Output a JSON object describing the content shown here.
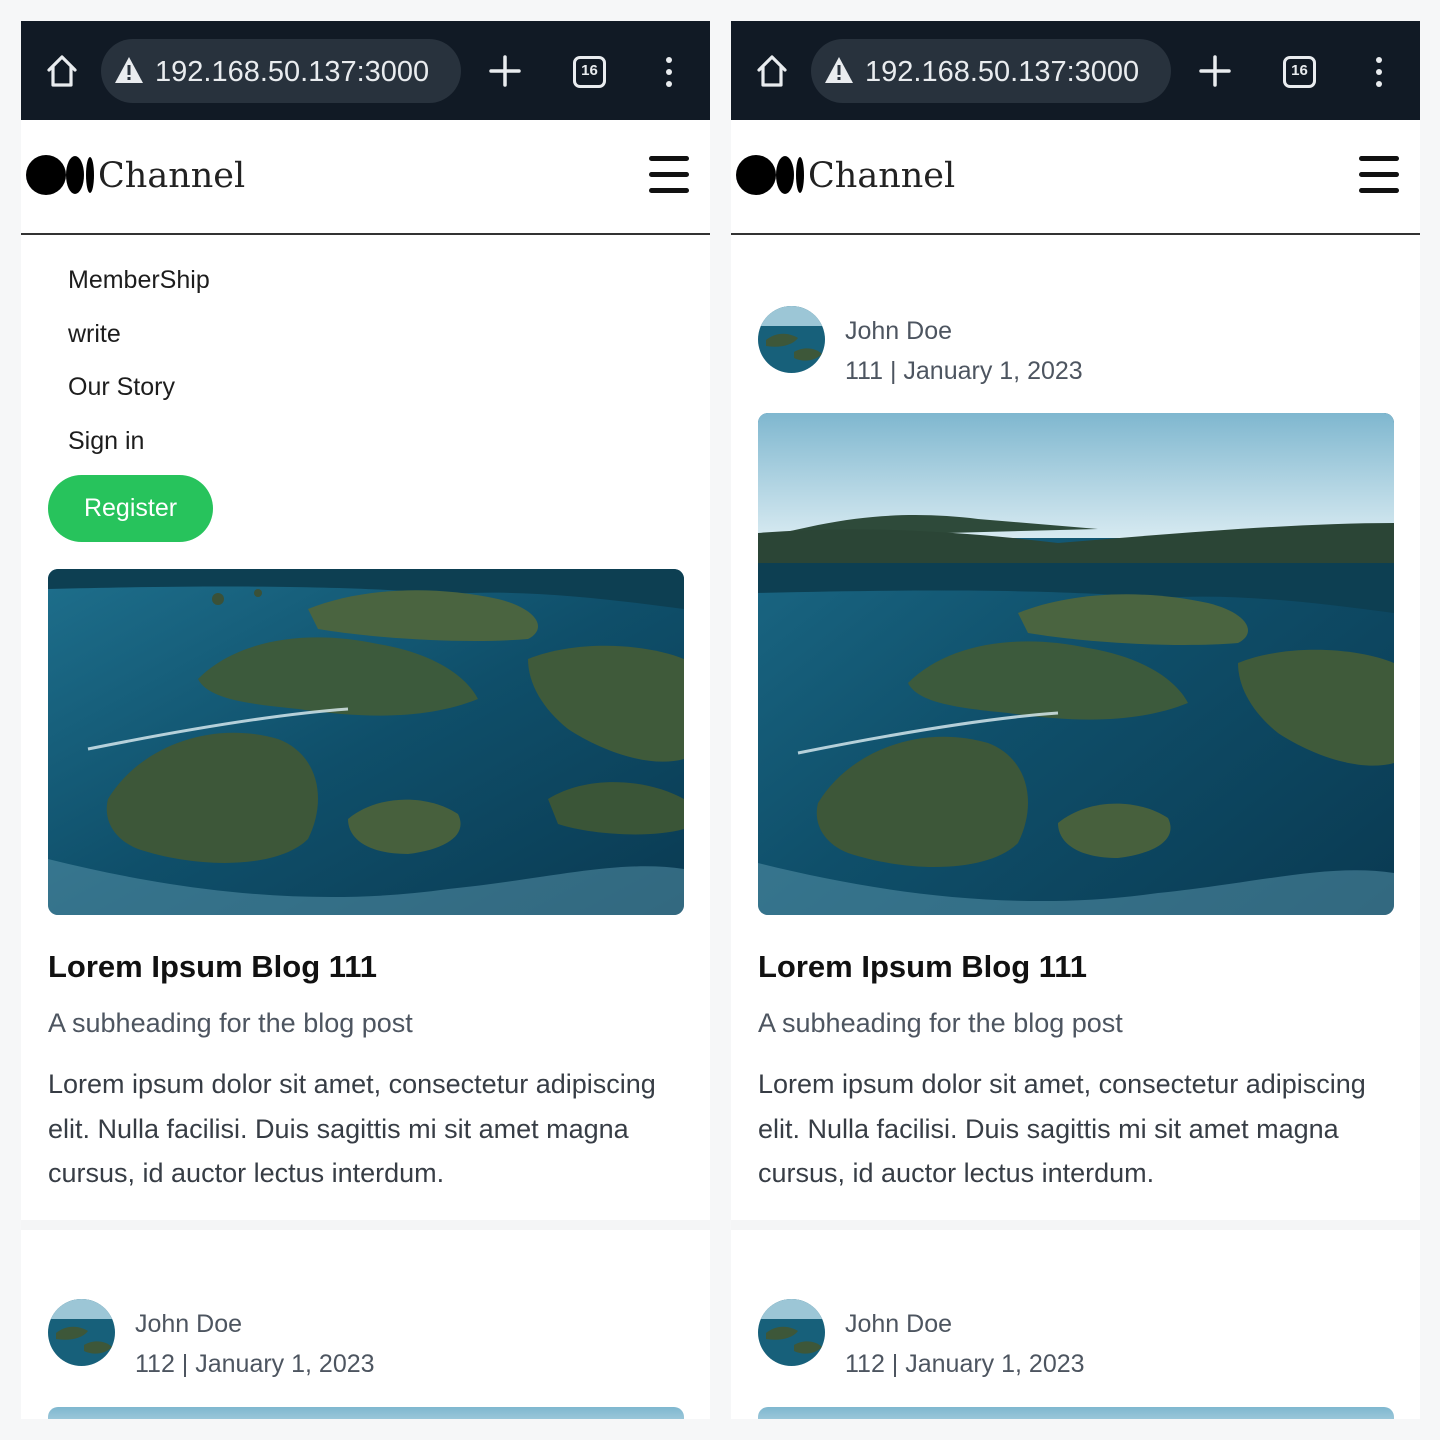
{
  "browser": {
    "url": "192.168.50.137:3000",
    "tab_count": "16"
  },
  "site": {
    "brand": "Channel"
  },
  "menu": {
    "items": [
      "MemberShip",
      "write",
      "Our Story",
      "Sign in"
    ],
    "register_label": "Register"
  },
  "post": {
    "title": "Lorem Ipsum Blog 111",
    "subheading": "A subheading for the blog post",
    "body": "Lorem ipsum dolor sit amet, consectetur adipiscing elit. Nulla facilisi. Duis sagittis mi sit amet magna cursus, id auctor lectus interdum."
  },
  "author": {
    "name": "John Doe",
    "meta_post_111": "111 | January 1, 2023",
    "meta_post_112": "112 | January 1, 2023"
  },
  "colors": {
    "chrome_bg": "#111a25",
    "url_pill": "#28323d",
    "register_green": "#27c35c",
    "header_rule": "#333333",
    "muted_text": "#4d5560"
  }
}
